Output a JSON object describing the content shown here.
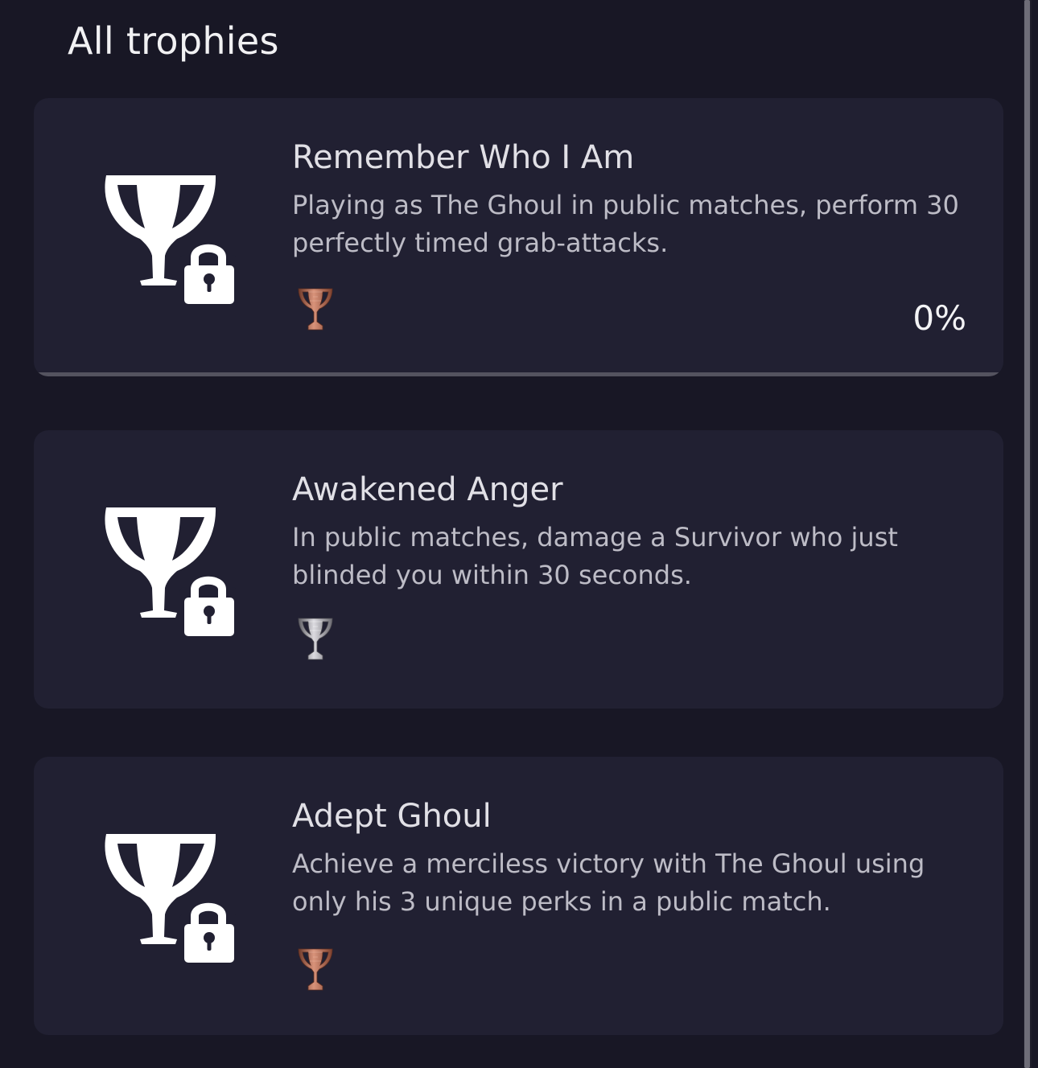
{
  "page": {
    "section_title": "All trophies"
  },
  "trophies": [
    {
      "name": "Remember Who I Am",
      "description": "Playing as The Ghoul in public matches, perform 30 perfectly timed grab-attacks.",
      "grade": "bronze",
      "grade_icon": "bronze-trophy-icon",
      "status_icon": "locked-trophy-icon",
      "progress": "0%",
      "progress_value": 0
    },
    {
      "name": "Awakened Anger",
      "description": "In public matches, damage a Survivor who just blinded you within 30 seconds.",
      "grade": "silver",
      "grade_icon": "silver-trophy-icon",
      "status_icon": "locked-trophy-icon"
    },
    {
      "name": "Adept Ghoul",
      "description": "Achieve a merciless victory with The Ghoul using only his 3 unique perks in a public match.",
      "grade": "bronze",
      "grade_icon": "bronze-trophy-icon",
      "status_icon": "locked-trophy-icon"
    }
  ],
  "colors": {
    "background": "#181725",
    "card": "#212032",
    "bronze": "#b46a52",
    "silver": "#a9a8ad",
    "text_primary": "#e1e0e6",
    "text_secondary": "#bdbcc6"
  }
}
